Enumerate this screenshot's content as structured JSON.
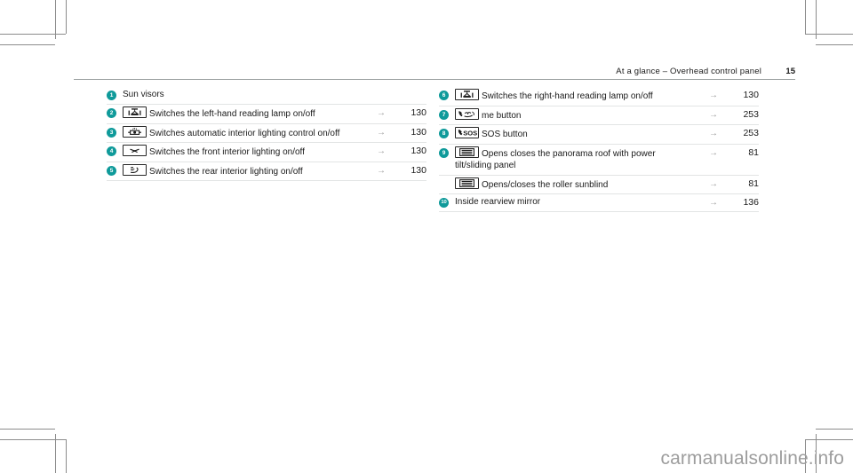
{
  "header": {
    "title": "At a glance – Overhead control panel",
    "page_number": "15"
  },
  "colors": {
    "bullet_teal": "#0f9a9a",
    "rule": "#e2e4e4",
    "header_rule": "#9aa0a0",
    "arrow": "#9b9b9b",
    "watermark": "#9d9d9d"
  },
  "arrow_symbol": "→",
  "left_column": [
    {
      "bullet": "1",
      "icon": null,
      "text": "Sun visors",
      "arrow": "",
      "page": ""
    },
    {
      "bullet": "2",
      "icon": "reading-lamp-left-icon",
      "text": "Switches the left-hand reading lamp on/off",
      "arrow": "→",
      "page": "130"
    },
    {
      "bullet": "3",
      "icon": "automatic-interior-lighting-icon",
      "text": "Switches automatic interior lighting control on/off",
      "arrow": "→",
      "page": "130"
    },
    {
      "bullet": "4",
      "icon": "front-interior-lighting-icon",
      "text": "Switches the front interior lighting on/off",
      "arrow": "→",
      "page": "130"
    },
    {
      "bullet": "5",
      "icon": "rear-interior-lighting-icon",
      "text": "Switches the rear interior lighting on/off",
      "arrow": "→",
      "page": "130"
    }
  ],
  "right_column": [
    {
      "bullet": "6",
      "icon": "reading-lamp-right-icon",
      "text": "Switches the right-hand reading lamp on/off",
      "arrow": "→",
      "page": "130"
    },
    {
      "bullet": "7",
      "icon": "me-button-icon",
      "text": "me button",
      "arrow": "→",
      "page": "253"
    },
    {
      "bullet": "8",
      "icon": "sos-button-icon",
      "text": "SOS button",
      "arrow": "→",
      "page": "253"
    },
    {
      "bullet": "9",
      "icon": "panorama-roof-icon",
      "text": "Opens closes the panorama roof with power tilt/sliding panel",
      "arrow": "→",
      "page": "81"
    },
    {
      "bullet": "",
      "icon": "roller-sunblind-icon",
      "text": "Opens/closes the roller sunblind",
      "arrow": "→",
      "page": "81"
    },
    {
      "bullet": "10",
      "icon": null,
      "text": "Inside rearview mirror",
      "arrow": "→",
      "page": "136"
    }
  ],
  "watermark": {
    "text": "carmanualsonline.info"
  }
}
